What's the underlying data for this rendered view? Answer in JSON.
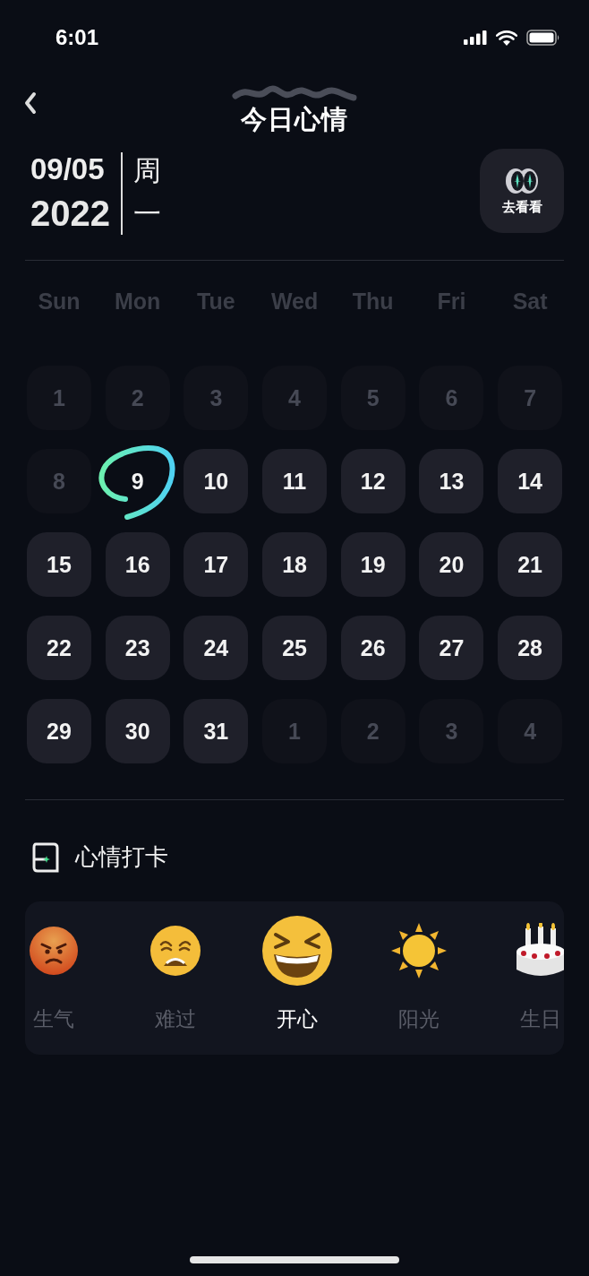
{
  "status_bar": {
    "time": "6:01"
  },
  "header": {
    "title": "今日心情"
  },
  "date": {
    "month_day": "09/05",
    "year": "2022",
    "weekday_prefix": "周",
    "weekday": "一"
  },
  "look_button": {
    "label": "去看看"
  },
  "weekdays": [
    "Sun",
    "Mon",
    "Tue",
    "Wed",
    "Thu",
    "Fri",
    "Sat"
  ],
  "days": [
    {
      "label": "1",
      "disabled": true,
      "selected": false
    },
    {
      "label": "2",
      "disabled": true,
      "selected": false
    },
    {
      "label": "3",
      "disabled": true,
      "selected": false
    },
    {
      "label": "4",
      "disabled": true,
      "selected": false
    },
    {
      "label": "5",
      "disabled": true,
      "selected": false
    },
    {
      "label": "6",
      "disabled": true,
      "selected": false
    },
    {
      "label": "7",
      "disabled": true,
      "selected": false
    },
    {
      "label": "8",
      "disabled": true,
      "selected": false
    },
    {
      "label": "9",
      "disabled": false,
      "selected": true
    },
    {
      "label": "10",
      "disabled": false,
      "selected": false
    },
    {
      "label": "11",
      "disabled": false,
      "selected": false
    },
    {
      "label": "12",
      "disabled": false,
      "selected": false
    },
    {
      "label": "13",
      "disabled": false,
      "selected": false
    },
    {
      "label": "14",
      "disabled": false,
      "selected": false
    },
    {
      "label": "15",
      "disabled": false,
      "selected": false
    },
    {
      "label": "16",
      "disabled": false,
      "selected": false
    },
    {
      "label": "17",
      "disabled": false,
      "selected": false
    },
    {
      "label": "18",
      "disabled": false,
      "selected": false
    },
    {
      "label": "19",
      "disabled": false,
      "selected": false
    },
    {
      "label": "20",
      "disabled": false,
      "selected": false
    },
    {
      "label": "21",
      "disabled": false,
      "selected": false
    },
    {
      "label": "22",
      "disabled": false,
      "selected": false
    },
    {
      "label": "23",
      "disabled": false,
      "selected": false
    },
    {
      "label": "24",
      "disabled": false,
      "selected": false
    },
    {
      "label": "25",
      "disabled": false,
      "selected": false
    },
    {
      "label": "26",
      "disabled": false,
      "selected": false
    },
    {
      "label": "27",
      "disabled": false,
      "selected": false
    },
    {
      "label": "28",
      "disabled": false,
      "selected": false
    },
    {
      "label": "29",
      "disabled": false,
      "selected": false
    },
    {
      "label": "30",
      "disabled": false,
      "selected": false
    },
    {
      "label": "31",
      "disabled": false,
      "selected": false
    },
    {
      "label": "1",
      "disabled": true,
      "selected": false
    },
    {
      "label": "2",
      "disabled": true,
      "selected": false
    },
    {
      "label": "3",
      "disabled": true,
      "selected": false
    },
    {
      "label": "4",
      "disabled": true,
      "selected": false
    }
  ],
  "mood_section": {
    "title": "心情打卡"
  },
  "moods": [
    {
      "kind": "angry",
      "label": "生气",
      "selected": false
    },
    {
      "kind": "weary",
      "label": "难过",
      "selected": false
    },
    {
      "kind": "laughing",
      "label": "开心",
      "selected": true
    },
    {
      "kind": "sun",
      "label": "阳光",
      "selected": false
    },
    {
      "kind": "cake",
      "label": "生日",
      "selected": false
    }
  ]
}
